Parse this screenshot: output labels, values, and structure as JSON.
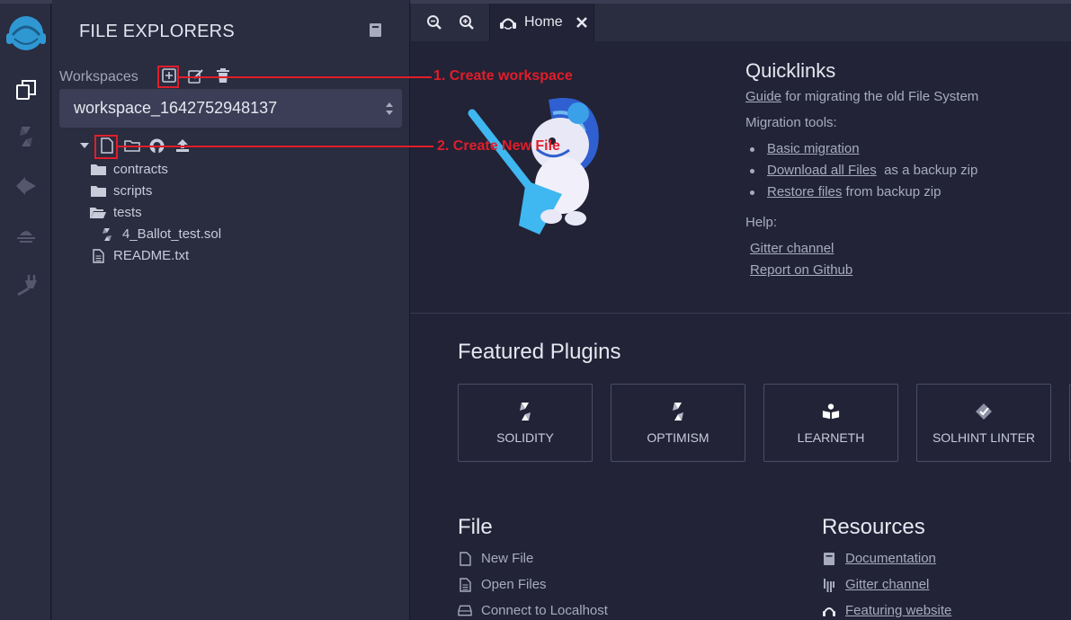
{
  "side_panel": {
    "title": "FILE EXPLORERS",
    "workspaces_label": "Workspaces",
    "selected_workspace": "workspace_1642752948137",
    "tree": [
      {
        "label": "contracts",
        "icon": "folder-icon"
      },
      {
        "label": "scripts",
        "icon": "folder-icon"
      },
      {
        "label": "tests",
        "icon": "folder-open-icon"
      },
      {
        "label": "4_Ballot_test.sol",
        "icon": "solidity-file-icon"
      },
      {
        "label": "README.txt",
        "icon": "text-file-icon"
      }
    ]
  },
  "tabs": {
    "home_label": "Home"
  },
  "home": {
    "quicklinks_title": "Quicklinks",
    "guide_link": "Guide",
    "guide_text": "for migrating the old File System",
    "migration_label": "Migration tools:",
    "migration_items": [
      {
        "link": "Basic migration",
        "text": ""
      },
      {
        "link": "Download all Files",
        "text": "as a backup zip"
      },
      {
        "link": "Restore files",
        "text": "from backup zip"
      }
    ],
    "help_label": "Help:",
    "help_links": [
      "Gitter channel",
      "Report on Github"
    ],
    "featured_title": "Featured Plugins",
    "plugins": [
      "SOLIDITY",
      "OPTIMISM",
      "LEARNETH",
      "SOLHINT LINTER"
    ],
    "file_title": "File",
    "file_actions": [
      "New File",
      "Open Files",
      "Connect to Localhost"
    ],
    "resources_title": "Resources",
    "resources": [
      "Documentation",
      "Gitter channel",
      "Featuring website"
    ]
  },
  "annotations": {
    "create_workspace": "1. Create workspace",
    "create_new_file": "2. Create New File"
  },
  "colors": {
    "background": "#222336",
    "panel": "#2a2c3f",
    "accent": "#2f98d3",
    "annotation": "#e01e2a"
  }
}
